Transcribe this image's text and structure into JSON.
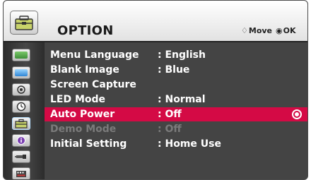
{
  "header": {
    "title": "OPTION",
    "move_glyph": "♢",
    "move_label": "Move",
    "ok_glyph": "◉",
    "ok_label": "OK"
  },
  "sidebar": {
    "icons": [
      {
        "name": "picture-menu-icon"
      },
      {
        "name": "screen-menu-icon"
      },
      {
        "name": "audio-menu-icon"
      },
      {
        "name": "time-menu-icon"
      },
      {
        "name": "option-menu-icon",
        "active": true
      },
      {
        "name": "info-menu-icon"
      },
      {
        "name": "input-menu-icon"
      },
      {
        "name": "media-menu-icon"
      }
    ]
  },
  "menu": {
    "items": [
      {
        "label": "Menu Language",
        "value": ": English"
      },
      {
        "label": "Blank Image",
        "value": ": Blue"
      },
      {
        "label": "Screen Capture",
        "value": ""
      },
      {
        "label": "LED Mode",
        "value": ": Normal"
      },
      {
        "label": "Auto Power",
        "value": ": Off",
        "selected": true
      },
      {
        "label": "Demo Mode",
        "value": ": Off",
        "disabled": true
      },
      {
        "label": "Initial Setting",
        "value": ": Home Use"
      }
    ]
  },
  "colors": {
    "selected_row": "#d40a45",
    "panel": "#444444",
    "disabled_text": "#7b7b7b"
  }
}
